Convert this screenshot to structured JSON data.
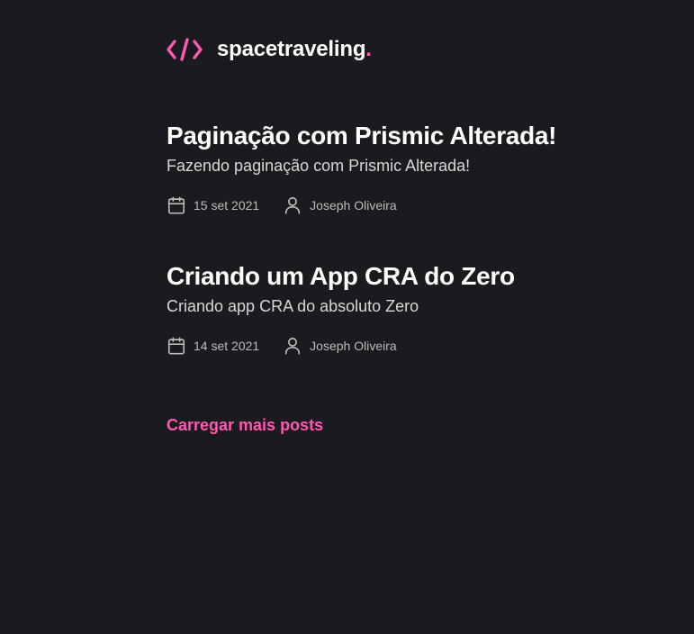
{
  "header": {
    "logo_text": "spacetraveling",
    "logo_dot": ".",
    "logo_icon": "code-brackets-icon",
    "accent_color": "#ff57b2"
  },
  "posts": [
    {
      "title": "Paginação com Prismic Alterada!",
      "subtitle": "Fazendo paginação com Prismic Alterada!",
      "date": "15 set 2021",
      "author": "Joseph Oliveira"
    },
    {
      "title": "Criando um App CRA do Zero",
      "subtitle": "Criando app CRA do absoluto Zero",
      "date": "14 set 2021",
      "author": "Joseph Oliveira"
    }
  ],
  "load_more": {
    "label": "Carregar mais posts"
  },
  "colors": {
    "background": "#1a1b1f",
    "title": "#ffffff",
    "subtitle": "#d7d7d7",
    "meta": "#bbbbbb"
  }
}
